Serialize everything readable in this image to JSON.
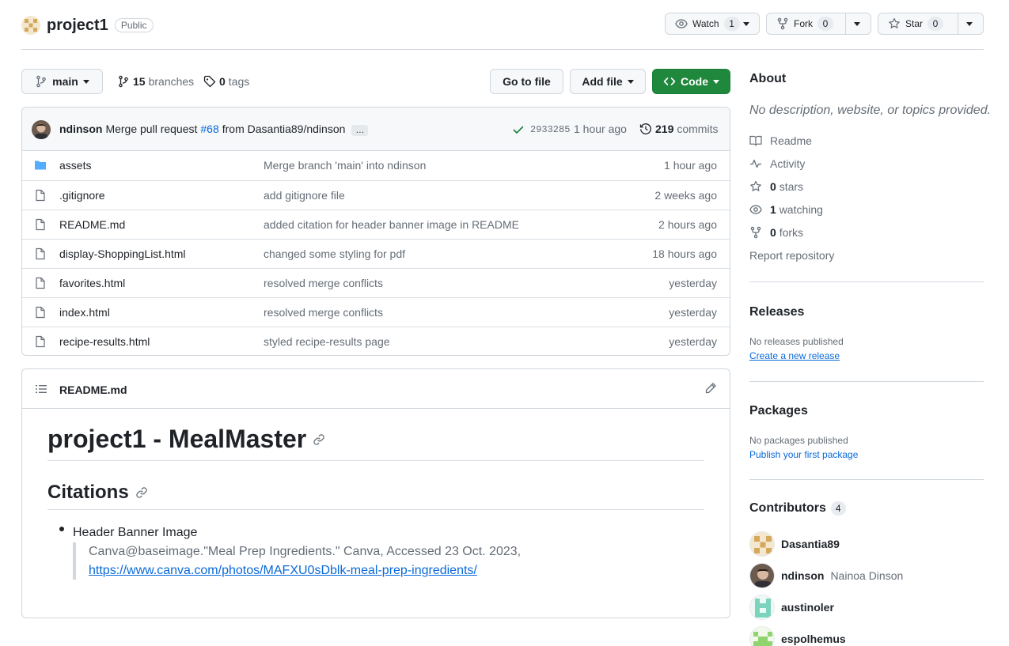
{
  "repo": {
    "name": "project1",
    "visibility": "Public"
  },
  "header_actions": {
    "watch_label": "Watch",
    "watch_count": "1",
    "fork_label": "Fork",
    "fork_count": "0",
    "star_label": "Star",
    "star_count": "0"
  },
  "toolbar": {
    "branch": "main",
    "branches_count": "15",
    "branches_label": "branches",
    "tags_count": "0",
    "tags_label": "tags",
    "go_to_file": "Go to file",
    "add_file": "Add file",
    "code": "Code"
  },
  "latest_commit": {
    "author": "ndinson",
    "message_prefix": "Merge pull request",
    "pr_link": "#68",
    "message_suffix": "from Dasantia89/ndinson",
    "ellipsis": "…",
    "sha": "2933285",
    "time": "1 hour ago",
    "commits_count": "219",
    "commits_label": "commits"
  },
  "files": [
    {
      "name": "assets",
      "type": "folder",
      "message": "Merge branch 'main' into ndinson",
      "time": "1 hour ago"
    },
    {
      "name": ".gitignore",
      "type": "file",
      "message": "add gitignore file",
      "time": "2 weeks ago"
    },
    {
      "name": "README.md",
      "type": "file",
      "message": "added citation for header banner image in README",
      "time": "2 hours ago"
    },
    {
      "name": "display-ShoppingList.html",
      "type": "file",
      "message": "changed some styling for pdf",
      "time": "18 hours ago"
    },
    {
      "name": "favorites.html",
      "type": "file",
      "message": "resolved merge conflicts",
      "time": "yesterday"
    },
    {
      "name": "index.html",
      "type": "file",
      "message": "resolved merge conflicts",
      "time": "yesterday"
    },
    {
      "name": "recipe-results.html",
      "type": "file",
      "message": "styled recipe-results page",
      "time": "yesterday"
    }
  ],
  "readme": {
    "filename": "README.md",
    "h1": "project1 - MealMaster",
    "h2": "Citations",
    "bullet": "Header Banner Image",
    "quote_text": "Canva@baseimage.\"Meal Prep Ingredients.\" Canva, Accessed 23 Oct. 2023,",
    "quote_link": "https://www.canva.com/photos/MAFXU0sDblk-meal-prep-ingredients/"
  },
  "about": {
    "heading": "About",
    "description": "No description, website, or topics provided.",
    "readme": "Readme",
    "activity": "Activity",
    "stars_count": "0",
    "stars_label": "stars",
    "watching_count": "1",
    "watching_label": "watching",
    "forks_count": "0",
    "forks_label": "forks",
    "report": "Report repository"
  },
  "releases": {
    "heading": "Releases",
    "empty": "No releases published",
    "create": "Create a new release"
  },
  "packages": {
    "heading": "Packages",
    "empty": "No packages published",
    "publish": "Publish your first package"
  },
  "contributors": {
    "heading": "Contributors",
    "count": "4",
    "list": [
      {
        "login": "Dasantia89",
        "name": ""
      },
      {
        "login": "ndinson",
        "name": "Nainoa Dinson"
      },
      {
        "login": "austinoler",
        "name": ""
      },
      {
        "login": "espolhemus",
        "name": ""
      }
    ]
  },
  "colors": {
    "accent_green": "#1f883d",
    "link_blue": "#0969da",
    "folder_blue": "#54aeff",
    "muted": "#656d76"
  }
}
